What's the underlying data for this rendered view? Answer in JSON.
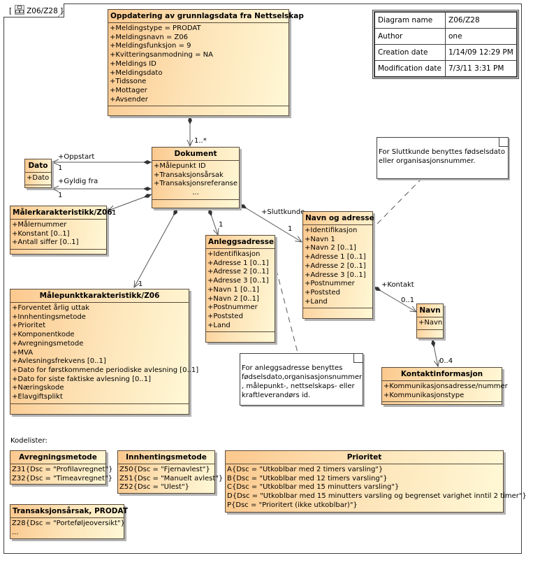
{
  "frame": {
    "tab_label": "Z06/Z28",
    "tab_icon": "class-diagram-icon"
  },
  "info_table": [
    {
      "key": "Diagram name",
      "value": "Z06/Z28"
    },
    {
      "key": "Author",
      "value": "one"
    },
    {
      "key": "Creation date",
      "value": "1/14/09 12:29 PM"
    },
    {
      "key": "Modification date",
      "value": "7/3/11 3:31 PM"
    }
  ],
  "classes": {
    "oppdatering": {
      "name": "Oppdatering av grunnlagsdata fra Nettselskap",
      "attributes": [
        "+Meldingstype = PRODAT",
        "+Meldingsnavn = Z06",
        "+Meldingsfunksjon = 9",
        "+Kvitteringsanmodning = NA",
        "+Meldings ID",
        "+Meldingsdato",
        "+Tidssone",
        "+Mottager",
        "+Avsender"
      ]
    },
    "dokument": {
      "name": "Dokument",
      "attributes": [
        "+Målepunkt ID",
        "+Transaksjonsårsak",
        "+Transaksjonsreferanse",
        "..."
      ]
    },
    "dato": {
      "name": "Dato",
      "attributes": [
        "+Dato"
      ]
    },
    "malerkarakteristikk": {
      "name": "Målerkarakteristikk/Z06",
      "attributes": [
        "+Målernummer",
        "+Konstant [0..1]",
        "+Antall siffer [0..1]"
      ]
    },
    "malepunktkarakteristikk": {
      "name": "Målepunktkarakteristikk/Z06",
      "attributes": [
        "+Forventet årlig uttak",
        "+Innhentingsmetode",
        "+Prioritet",
        "+Komponentkode",
        "+Avregningsmetode",
        "+MVA",
        "+Avlesningsfrekvens [0..1]",
        "+Dato for førstkommende periodiske avlesning [0..1]",
        "+Dato for siste faktiske avlesning [0..1]",
        "+Næringskode",
        "+Elavgiftsplikt"
      ]
    },
    "anleggsadresse": {
      "name": "Anleggsadresse",
      "attributes": [
        "+Identifikasjon",
        "+Adresse 1 [0..1]",
        "+Adresse 2 [0..1]",
        "+Adresse 3 [0..1]",
        "+Navn 1 [0..1]",
        "+Navn 2 [0..1]",
        "+Postnummer",
        "+Poststed",
        "+Land"
      ]
    },
    "navn_og_adresse": {
      "name": "Navn og adresse",
      "attributes": [
        "+Identifikasjon",
        "+Navn 1",
        "+Navn 2 [0..1]",
        "+Adresse 1 [0..1]",
        "+Adresse 2 [0..1]",
        "+Adresse 3 [0..1]",
        "+Postnummer",
        "+Poststed",
        "+Land"
      ]
    },
    "navn": {
      "name": "Navn",
      "attributes": [
        "+Navn"
      ]
    },
    "kontaktinformasjon": {
      "name": "Kontaktinformasjon",
      "attributes": [
        "+Kommunikasjonsadresse/nummer",
        "+Kommunikasjonstype"
      ]
    }
  },
  "associations": {
    "oppdatering_dokument": "1..*",
    "oppstart_role": "+Oppstart",
    "oppstart_mult": "1",
    "gyldig_fra_role": "+Gyldig fra",
    "gyldig_fra_mult": "1",
    "maler_mult": "1",
    "malepunkt_mult": "1",
    "anlegg_mult": "1",
    "sluttkunde_role": "+Sluttkunde",
    "sluttkunde_mult": "1",
    "kontakt_role": "+Kontakt",
    "kontakt_mult": "0..1",
    "kontaktinfo_mult": "0..4"
  },
  "notes": {
    "sluttkunde": "For Sluttkunde benyttes fødselsdato eller organisasjonsnummer.",
    "anleggsadresse": "For anleggsadresse benyttes fødselsdato,organisasjonsnummer , målepunkt-, nettselskaps- eller kraftleverandørs id."
  },
  "kodelister": {
    "label": "Kodelister:",
    "avregningsmetode": {
      "name": "Avregningsmetode",
      "literals": [
        "Z31{Dsc = \"Profilavregnet\"}",
        "Z32{Dsc = \"Timeavregnet\"}"
      ]
    },
    "innhentingsmetode": {
      "name": "Innhentingsmetode",
      "literals": [
        "Z50{Dsc = \"Fjernavlest\"}",
        "Z51{Dsc = \"Manuelt avlest\"}",
        "Z52{Dsc = \"Ulest\"}"
      ]
    },
    "prioritet": {
      "name": "Prioritet",
      "literals": [
        "A{Dsc = \"Utkoblbar med 2 timers varsling\"}",
        "B{Dsc = \"Utkoblbar med 12 timers varsling\"}",
        "C{Dsc = \"Utkoblbar med 15 minutters varsling\"}",
        "D{Dsc = \"Utkoblbar med 15 minutters varsling og begrenset varighet inntil 2 timer\"}",
        "P{Dsc = \"Prioritert (ikke utkoblbar)\"}"
      ]
    },
    "transaksjonsarsak": {
      "name": "Transaksjonsårsak, PRODAT",
      "literals": [
        "Z28{Dsc = \"Porteføljeoversikt\"}",
        "..."
      ]
    }
  }
}
